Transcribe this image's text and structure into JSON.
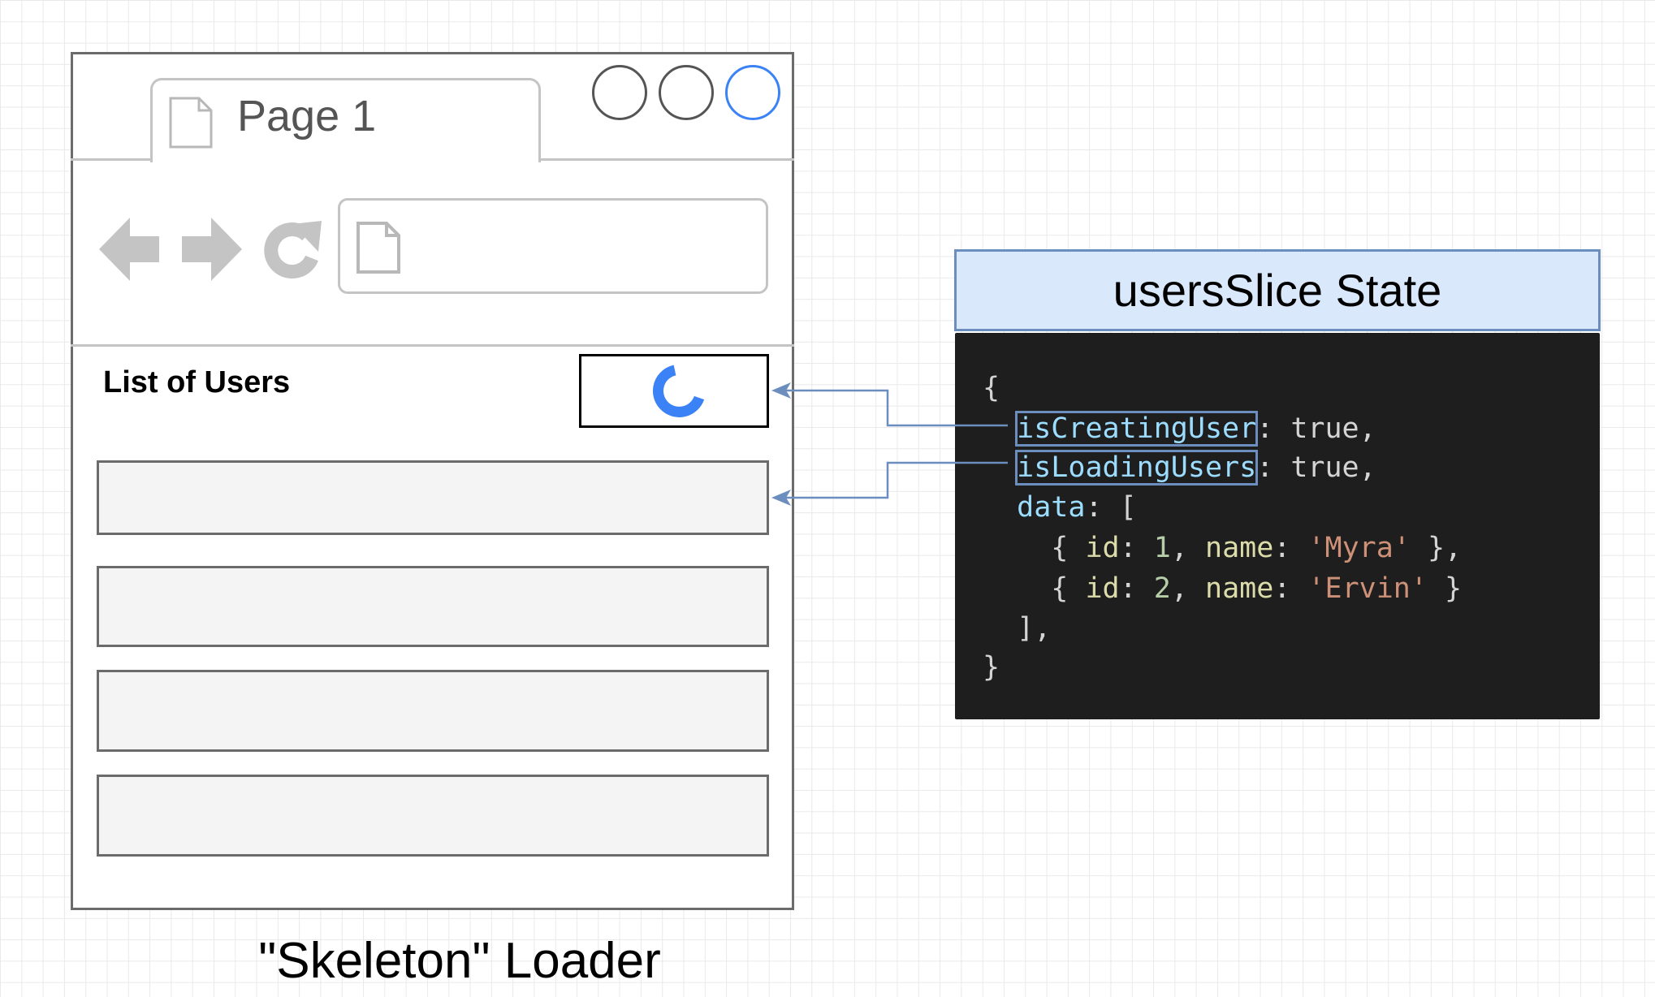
{
  "browser": {
    "tab_title": "Page 1",
    "window_buttons": [
      "minimize-circle",
      "maximize-circle",
      "close-circle"
    ],
    "nav_icons": [
      "back-arrow-icon",
      "forward-arrow-icon",
      "reload-icon",
      "page-icon"
    ],
    "list_title": "List of Users",
    "loader_rows": 4,
    "accent_color": "#3b82f6"
  },
  "caption": "\"Skeleton\" Loader",
  "state": {
    "header": "usersSlice State",
    "header_fill": "#dae8fc",
    "header_border": "#6c8ebf",
    "code": {
      "open": "{",
      "is_creating_key": "isCreatingUser",
      "is_creating_val": ": true,",
      "is_loading_key": "isLoadingUsers",
      "is_loading_val": ": true,",
      "data_key": "data",
      "data_open": ": [",
      "row1": {
        "open": "{ ",
        "id_key": "id",
        "id_sep": ": ",
        "id": "1",
        "comma": ", ",
        "name_key": "name",
        "name_sep": ": ",
        "name": "'Myra'",
        "close": " },"
      },
      "row2": {
        "open": "{ ",
        "id_key": "id",
        "id_sep": ": ",
        "id": "2",
        "comma": ", ",
        "name_key": "name",
        "name_sep": ": ",
        "name": "'Ervin'",
        "close": " }"
      },
      "data_close": "],",
      "close": "}"
    }
  }
}
